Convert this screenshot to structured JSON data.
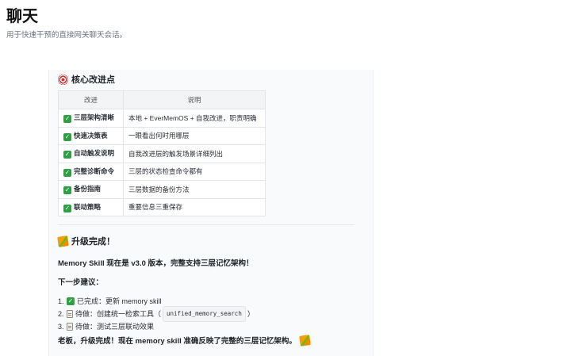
{
  "header": {
    "title": "聊天",
    "subtitle": "用于快速干预的直接网关聊天会话。"
  },
  "message": {
    "section1": {
      "icon": "target-icon",
      "title": "核心改进点"
    },
    "table": {
      "headers": [
        "改进",
        "说明"
      ],
      "rows": [
        {
          "name": "三层架构清晰",
          "desc": "本地 + EverMemOS + 自我改进，职责明确"
        },
        {
          "name": "快速决策表",
          "desc": "一眼看出何时用哪层"
        },
        {
          "name": "自动触发说明",
          "desc": "自我改进层的触发场景详细列出"
        },
        {
          "name": "完整诊断命令",
          "desc": "三层的状态检查命令都有"
        },
        {
          "name": "备份指南",
          "desc": "三层数据的备份方法"
        },
        {
          "name": "联动策略",
          "desc": "重要信息三重保存"
        }
      ]
    },
    "section2": {
      "icon": "party-popper-icon",
      "title": "升级完成！"
    },
    "summary": "Memory Skill 现在是 v3.0 版本，完整支持三层记忆架构！",
    "next_steps_title": "下一步建议：",
    "steps": {
      "s1": {
        "num": "1.",
        "text": "已完成：更新 memory skill"
      },
      "s2": {
        "num": "2.",
        "text_before": "待做：创建统一检索工具（",
        "code": "unified_memory_search",
        "text_after": "）"
      },
      "s3": {
        "num": "3.",
        "text": "待做：测试三层联动效果"
      }
    },
    "closing": "老板，升级完成！现在 memory skill 准确反映了完整的三层记忆架构。"
  }
}
